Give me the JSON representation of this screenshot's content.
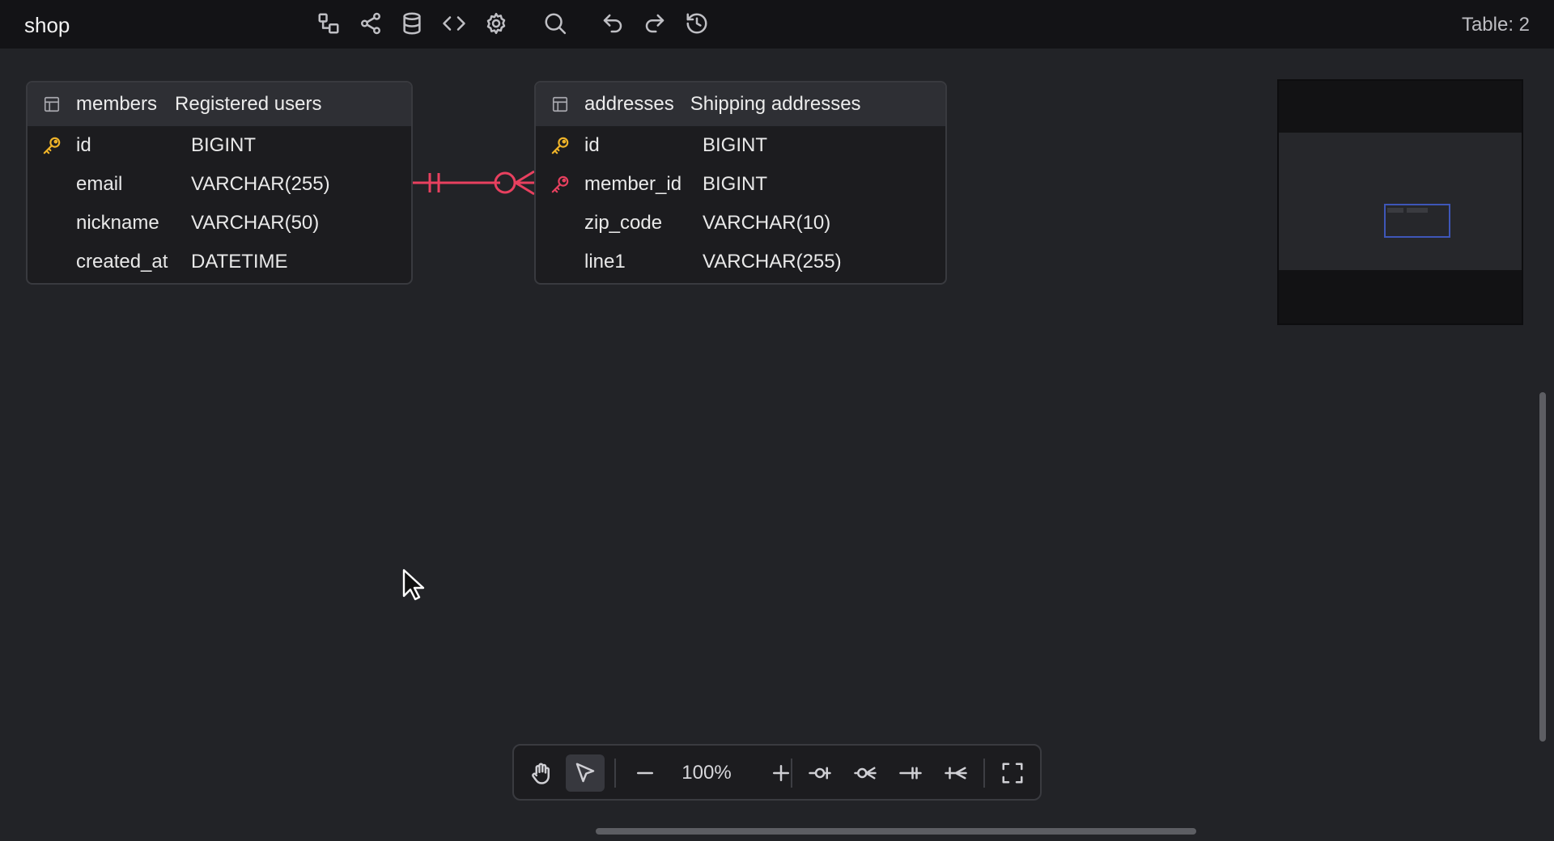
{
  "app": {
    "title": "shop",
    "table_count": "Table: 2"
  },
  "toolbar_icons": [
    "diagram-icon",
    "share-icon",
    "database-icon",
    "code-icon",
    "gear-icon",
    "search-icon",
    "undo-icon",
    "redo-icon",
    "history-icon"
  ],
  "tables": [
    {
      "name": "members",
      "comment": "Registered users",
      "columns": [
        {
          "name": "id",
          "type": "BIGINT",
          "key": "primary"
        },
        {
          "name": "email",
          "type": "VARCHAR(255)",
          "key": ""
        },
        {
          "name": "nickname",
          "type": "VARCHAR(50)",
          "key": ""
        },
        {
          "name": "created_at",
          "type": "DATETIME",
          "key": ""
        }
      ]
    },
    {
      "name": "addresses",
      "comment": "Shipping addresses",
      "columns": [
        {
          "name": "id",
          "type": "BIGINT",
          "key": "primary"
        },
        {
          "name": "member_id",
          "type": "BIGINT",
          "key": "foreign"
        },
        {
          "name": "zip_code",
          "type": "VARCHAR(10)",
          "key": ""
        },
        {
          "name": "line1",
          "type": "VARCHAR(255)",
          "key": ""
        }
      ]
    }
  ],
  "relationship": {
    "from": "members.id",
    "to": "addresses.member_id",
    "from_cardinality": "one-and-only-one",
    "to_cardinality": "zero-or-many",
    "color": "#e8405f"
  },
  "bottom_toolbar": {
    "zoom": "100%",
    "tools": [
      "hand-icon",
      "pointer-icon",
      "zoom-out-icon",
      "zoom-in-icon",
      "zero-or-one-icon",
      "zero-or-many-icon",
      "one-only-icon",
      "one-or-many-icon",
      "fullscreen-icon"
    ]
  },
  "colors": {
    "primary_key": "#f0b429",
    "foreign_key": "#e8405f",
    "minimap_viewport": "#3e56b8"
  }
}
